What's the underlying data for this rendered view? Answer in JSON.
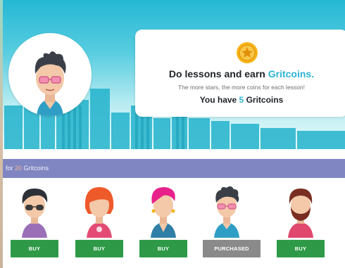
{
  "hero": {
    "headline_prefix": "Do lessons and earn ",
    "headline_accent": "Gritcoins.",
    "subline": "The more stars, the more coins for each lesson!",
    "balance_prefix": "You have ",
    "balance_value": "5",
    "balance_suffix": " Gritcoins",
    "coin_icon": "star-coin-icon",
    "colors": {
      "sky_top": "#25b8d4",
      "accent": "#2bb4d4",
      "coin": "#f7b316"
    }
  },
  "shop": {
    "band_prefix": "for ",
    "band_price": "20",
    "band_suffix": " Gritcoins",
    "band_color": "#7f86c1",
    "items": [
      {
        "avatar": "avatar-dark-hair-glasses-icon",
        "button_label": "BUY",
        "state": "buy"
      },
      {
        "avatar": "avatar-orange-hair-icon",
        "button_label": "BUY",
        "state": "buy"
      },
      {
        "avatar": "avatar-pink-hair-icon",
        "button_label": "BUY",
        "state": "buy"
      },
      {
        "avatar": "avatar-spiky-hair-pink-glasses-icon",
        "button_label": "PURCHASED",
        "state": "purchased"
      },
      {
        "avatar": "avatar-bearded-icon",
        "button_label": "BUY",
        "state": "buy"
      }
    ],
    "colors": {
      "buy": "#2e9a47",
      "purchased": "#8a8a8a"
    }
  }
}
